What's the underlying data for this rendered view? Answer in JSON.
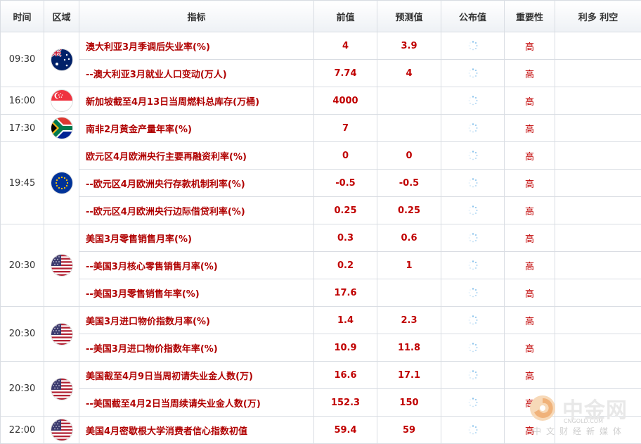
{
  "header": {
    "time": "时间",
    "region": "区域",
    "indicator": "指标",
    "previous": "前值",
    "forecast": "预测值",
    "published": "公布值",
    "importance": "重要性",
    "bull_bear": "利多 利空"
  },
  "groups": [
    {
      "time": "09:30",
      "flag": "au-flag-icon",
      "rows": [
        {
          "indicator": "澳大利亚3月季调后失业率(%)",
          "previous": "4",
          "forecast": "3.9",
          "importance": "高"
        },
        {
          "indicator": "--澳大利亚3月就业人口变动(万人)",
          "previous": "7.74",
          "forecast": "4",
          "importance": "高"
        }
      ]
    },
    {
      "time": "16:00",
      "flag": "sg-flag-icon",
      "rows": [
        {
          "indicator": "新加坡截至4月13日当周燃料总库存(万桶)",
          "previous": "4000",
          "forecast": "",
          "importance": "高"
        }
      ]
    },
    {
      "time": "17:30",
      "flag": "za-flag-icon",
      "rows": [
        {
          "indicator": "南非2月黄金产量年率(%)",
          "previous": "7",
          "forecast": "",
          "importance": "高"
        }
      ]
    },
    {
      "time": "19:45",
      "flag": "eu-flag-icon",
      "rows": [
        {
          "indicator": "欧元区4月欧洲央行主要再融资利率(%)",
          "previous": "0",
          "forecast": "0",
          "importance": "高"
        },
        {
          "indicator": "--欧元区4月欧洲央行存款机制利率(%)",
          "previous": "-0.5",
          "forecast": "-0.5",
          "importance": "高"
        },
        {
          "indicator": "--欧元区4月欧洲央行边际借贷利率(%)",
          "previous": "0.25",
          "forecast": "0.25",
          "importance": "高"
        }
      ]
    },
    {
      "time": "20:30",
      "flag": "us-flag-icon",
      "rows": [
        {
          "indicator": "美国3月零售销售月率(%)",
          "previous": "0.3",
          "forecast": "0.6",
          "importance": "高"
        },
        {
          "indicator": "--美国3月核心零售销售月率(%)",
          "previous": "0.2",
          "forecast": "1",
          "importance": "高"
        },
        {
          "indicator": "--美国3月零售销售年率(%)",
          "previous": "17.6",
          "forecast": "",
          "importance": "高"
        }
      ]
    },
    {
      "time": "20:30",
      "flag": "us-flag-icon",
      "rows": [
        {
          "indicator": "美国3月进口物价指数月率(%)",
          "previous": "1.4",
          "forecast": "2.3",
          "importance": "高"
        },
        {
          "indicator": "--美国3月进口物价指数年率(%)",
          "previous": "10.9",
          "forecast": "11.8",
          "importance": "高"
        }
      ]
    },
    {
      "time": "20:30",
      "flag": "us-flag-icon",
      "rows": [
        {
          "indicator": "美国截至4月9日当周初请失业金人数(万)",
          "previous": "16.6",
          "forecast": "17.1",
          "importance": "高"
        },
        {
          "indicator": "--美国截至4月2日当周续请失业金人数(万)",
          "previous": "152.3",
          "forecast": "150",
          "importance": "高"
        }
      ]
    },
    {
      "time": "22:00",
      "flag": "us-flag-icon",
      "rows": [
        {
          "indicator": "美国4月密歇根大学消费者信心指数初值",
          "previous": "59.4",
          "forecast": "59",
          "importance": "高"
        }
      ]
    }
  ],
  "watermark": {
    "name": "中金网",
    "domain": "CNGOLD.COM",
    "tagline": "中文财经新媒体"
  },
  "colors": {
    "accent": "#c00000",
    "header_bg": "#eef1f5",
    "border": "#d9dde3"
  }
}
